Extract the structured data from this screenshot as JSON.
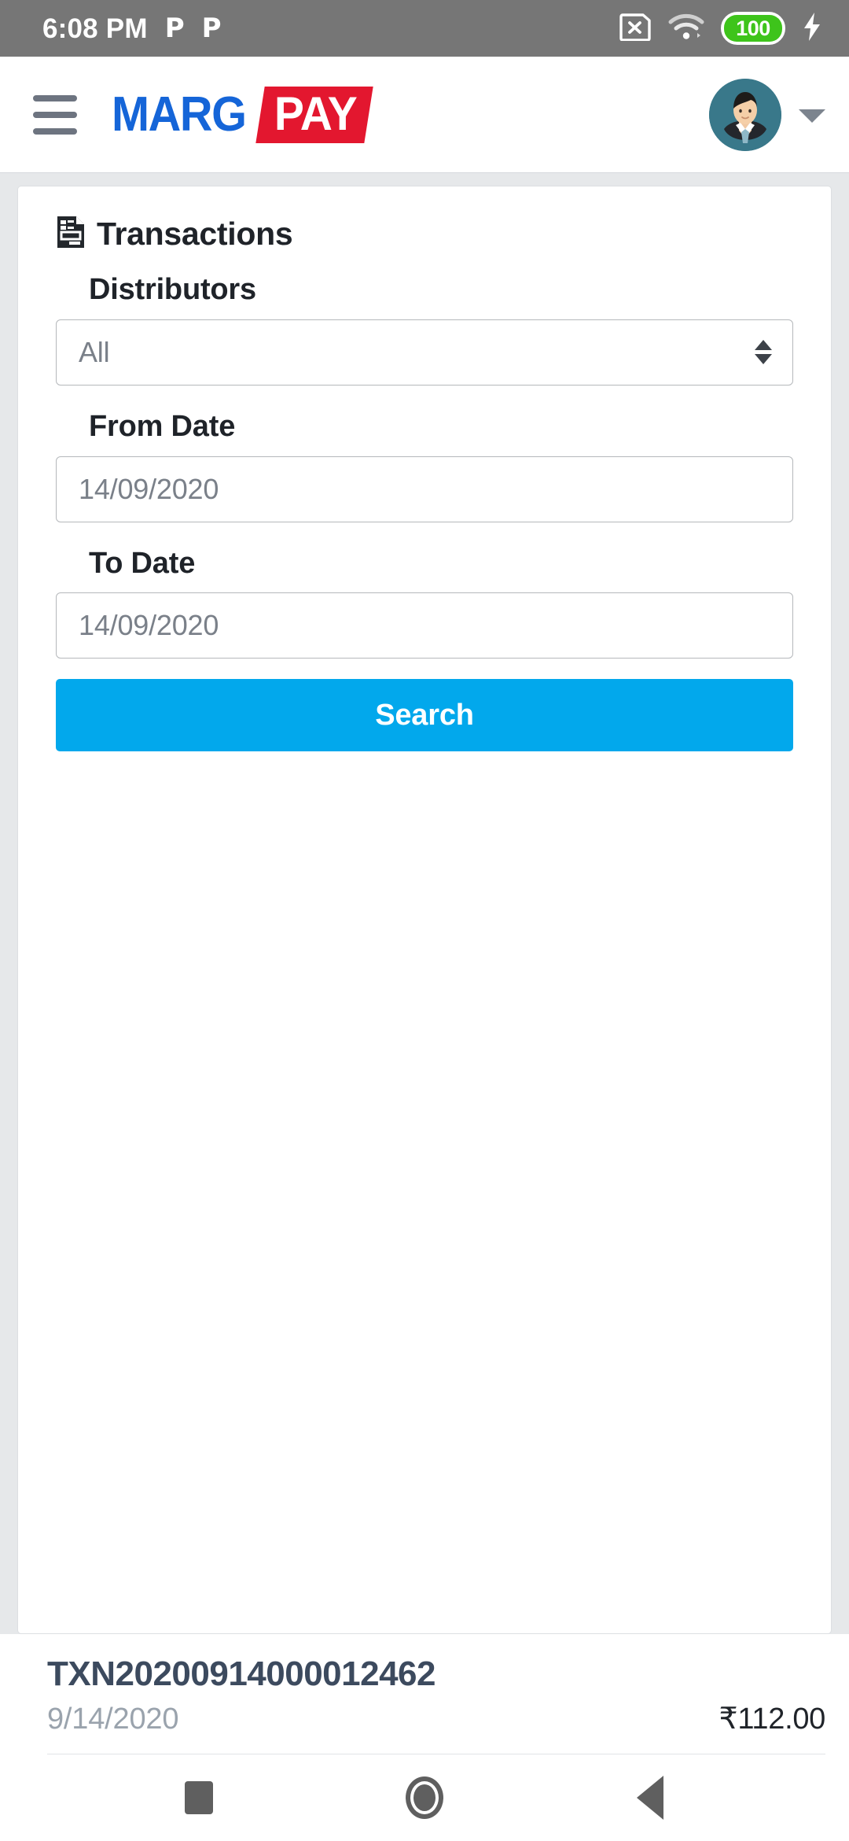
{
  "status_bar": {
    "time": "6:08 PM",
    "notification_icons": [
      "P",
      "P"
    ],
    "sim_icon": "sim-card-off-icon",
    "wifi_icon": "wifi-icon",
    "battery_level": "100",
    "charging_icon": "charging-bolt-icon",
    "background": "#767676"
  },
  "header": {
    "menu_icon": "hamburger-menu-icon",
    "brand_primary": "MARG",
    "brand_secondary": "PAY",
    "brand_primary_color": "#1565d8",
    "brand_secondary_bg": "#e3172f",
    "avatar_icon": "user-avatar-icon",
    "chevron_icon": "chevron-down-icon"
  },
  "card": {
    "icon": "document-icon",
    "title": "Transactions",
    "fields": {
      "distributors": {
        "label": "Distributors",
        "value": "All",
        "stepper_icon": "updown-stepper-icon"
      },
      "from_date": {
        "label": "From Date",
        "placeholder": "14/09/2020",
        "value": ""
      },
      "to_date": {
        "label": "To Date",
        "placeholder": "14/09/2020",
        "value": ""
      }
    },
    "search_button": {
      "label": "Search",
      "color": "#02a8ec"
    }
  },
  "transactions": [
    {
      "id": "TXN20200914000012462",
      "date": "9/14/2020",
      "amount": "₹112.00"
    }
  ],
  "nav_bar": {
    "recents_icon": "recents-square-icon",
    "home_icon": "home-circle-icon",
    "back_icon": "back-triangle-icon"
  }
}
